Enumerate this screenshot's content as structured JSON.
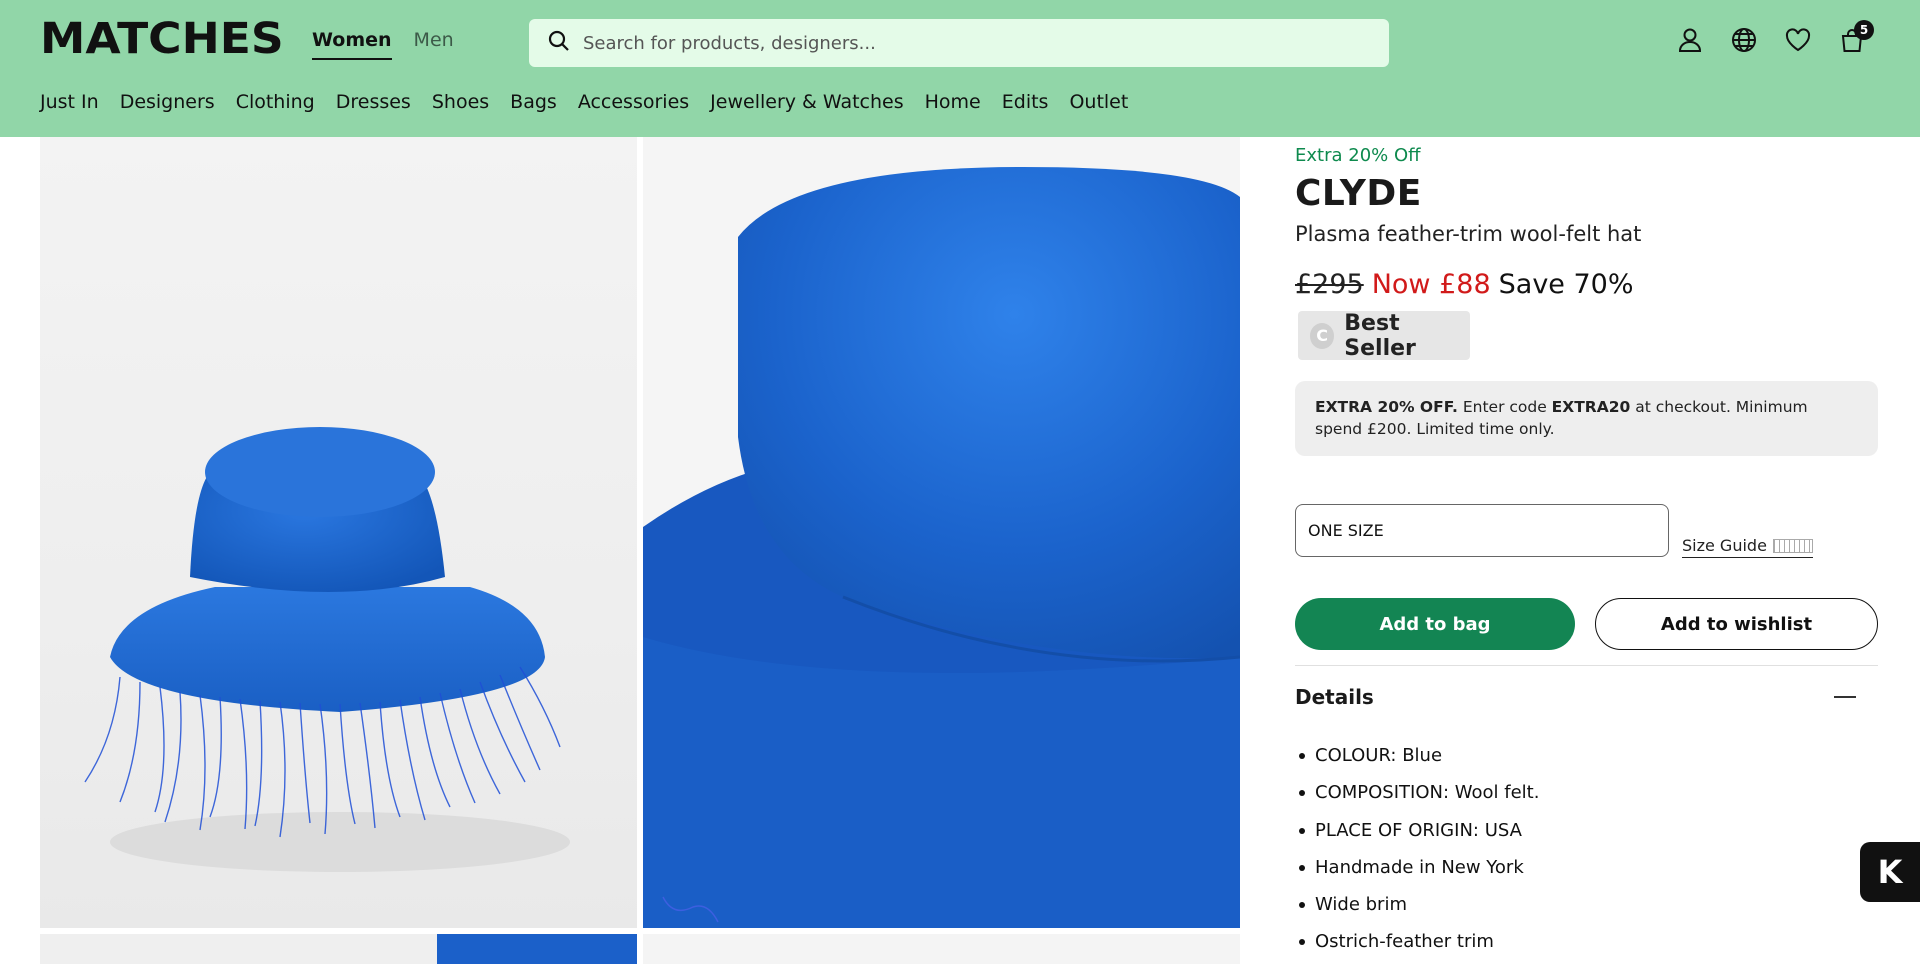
{
  "header": {
    "logo": "MATCHES",
    "gender_tabs": [
      {
        "label": "Women",
        "active": true
      },
      {
        "label": "Men",
        "active": false
      }
    ],
    "search": {
      "placeholder": "Search for products, designers..."
    },
    "icons": [
      "account-icon",
      "globe-icon",
      "wishlist-heart-icon",
      "bag-icon"
    ],
    "bag_count": "5",
    "categories": [
      "Just In",
      "Designers",
      "Clothing",
      "Dresses",
      "Shoes",
      "Bags",
      "Accessories",
      "Jewellery & Watches",
      "Home",
      "Edits",
      "Outlet"
    ],
    "background_color": "#91d6a8"
  },
  "product": {
    "promo_tag": "Extra 20% Off",
    "brand": "CLYDE",
    "name": "Plasma feather-trim wool-felt hat",
    "price_was": "£295",
    "price_now": "Now £88",
    "price_save": "Save 70%",
    "badge": "Best Seller",
    "promo_box": {
      "bold1": "EXTRA 20% OFF.",
      "text1": " Enter code ",
      "bold2": "EXTRA20",
      "text2": " at checkout. Minimum spend £200. Limited time only."
    },
    "size_value": "ONE SIZE",
    "size_guide_label": "Size Guide",
    "add_to_bag_label": "Add to bag",
    "add_to_wishlist_label": "Add to wishlist",
    "details_title": "Details",
    "details": [
      "COLOUR: Blue",
      "COMPOSITION: Wool felt.",
      "PLACE OF ORIGIN: USA",
      "Handmade in New York",
      "Wide brim",
      "Ostrich-feather trim"
    ],
    "colors": {
      "accent_green": "#138553",
      "sale_red": "#d11a1a",
      "promo_green": "#0e8a4e",
      "hat_blue": "#1b60c9"
    }
  },
  "widget": {
    "klarna_label": "K"
  }
}
